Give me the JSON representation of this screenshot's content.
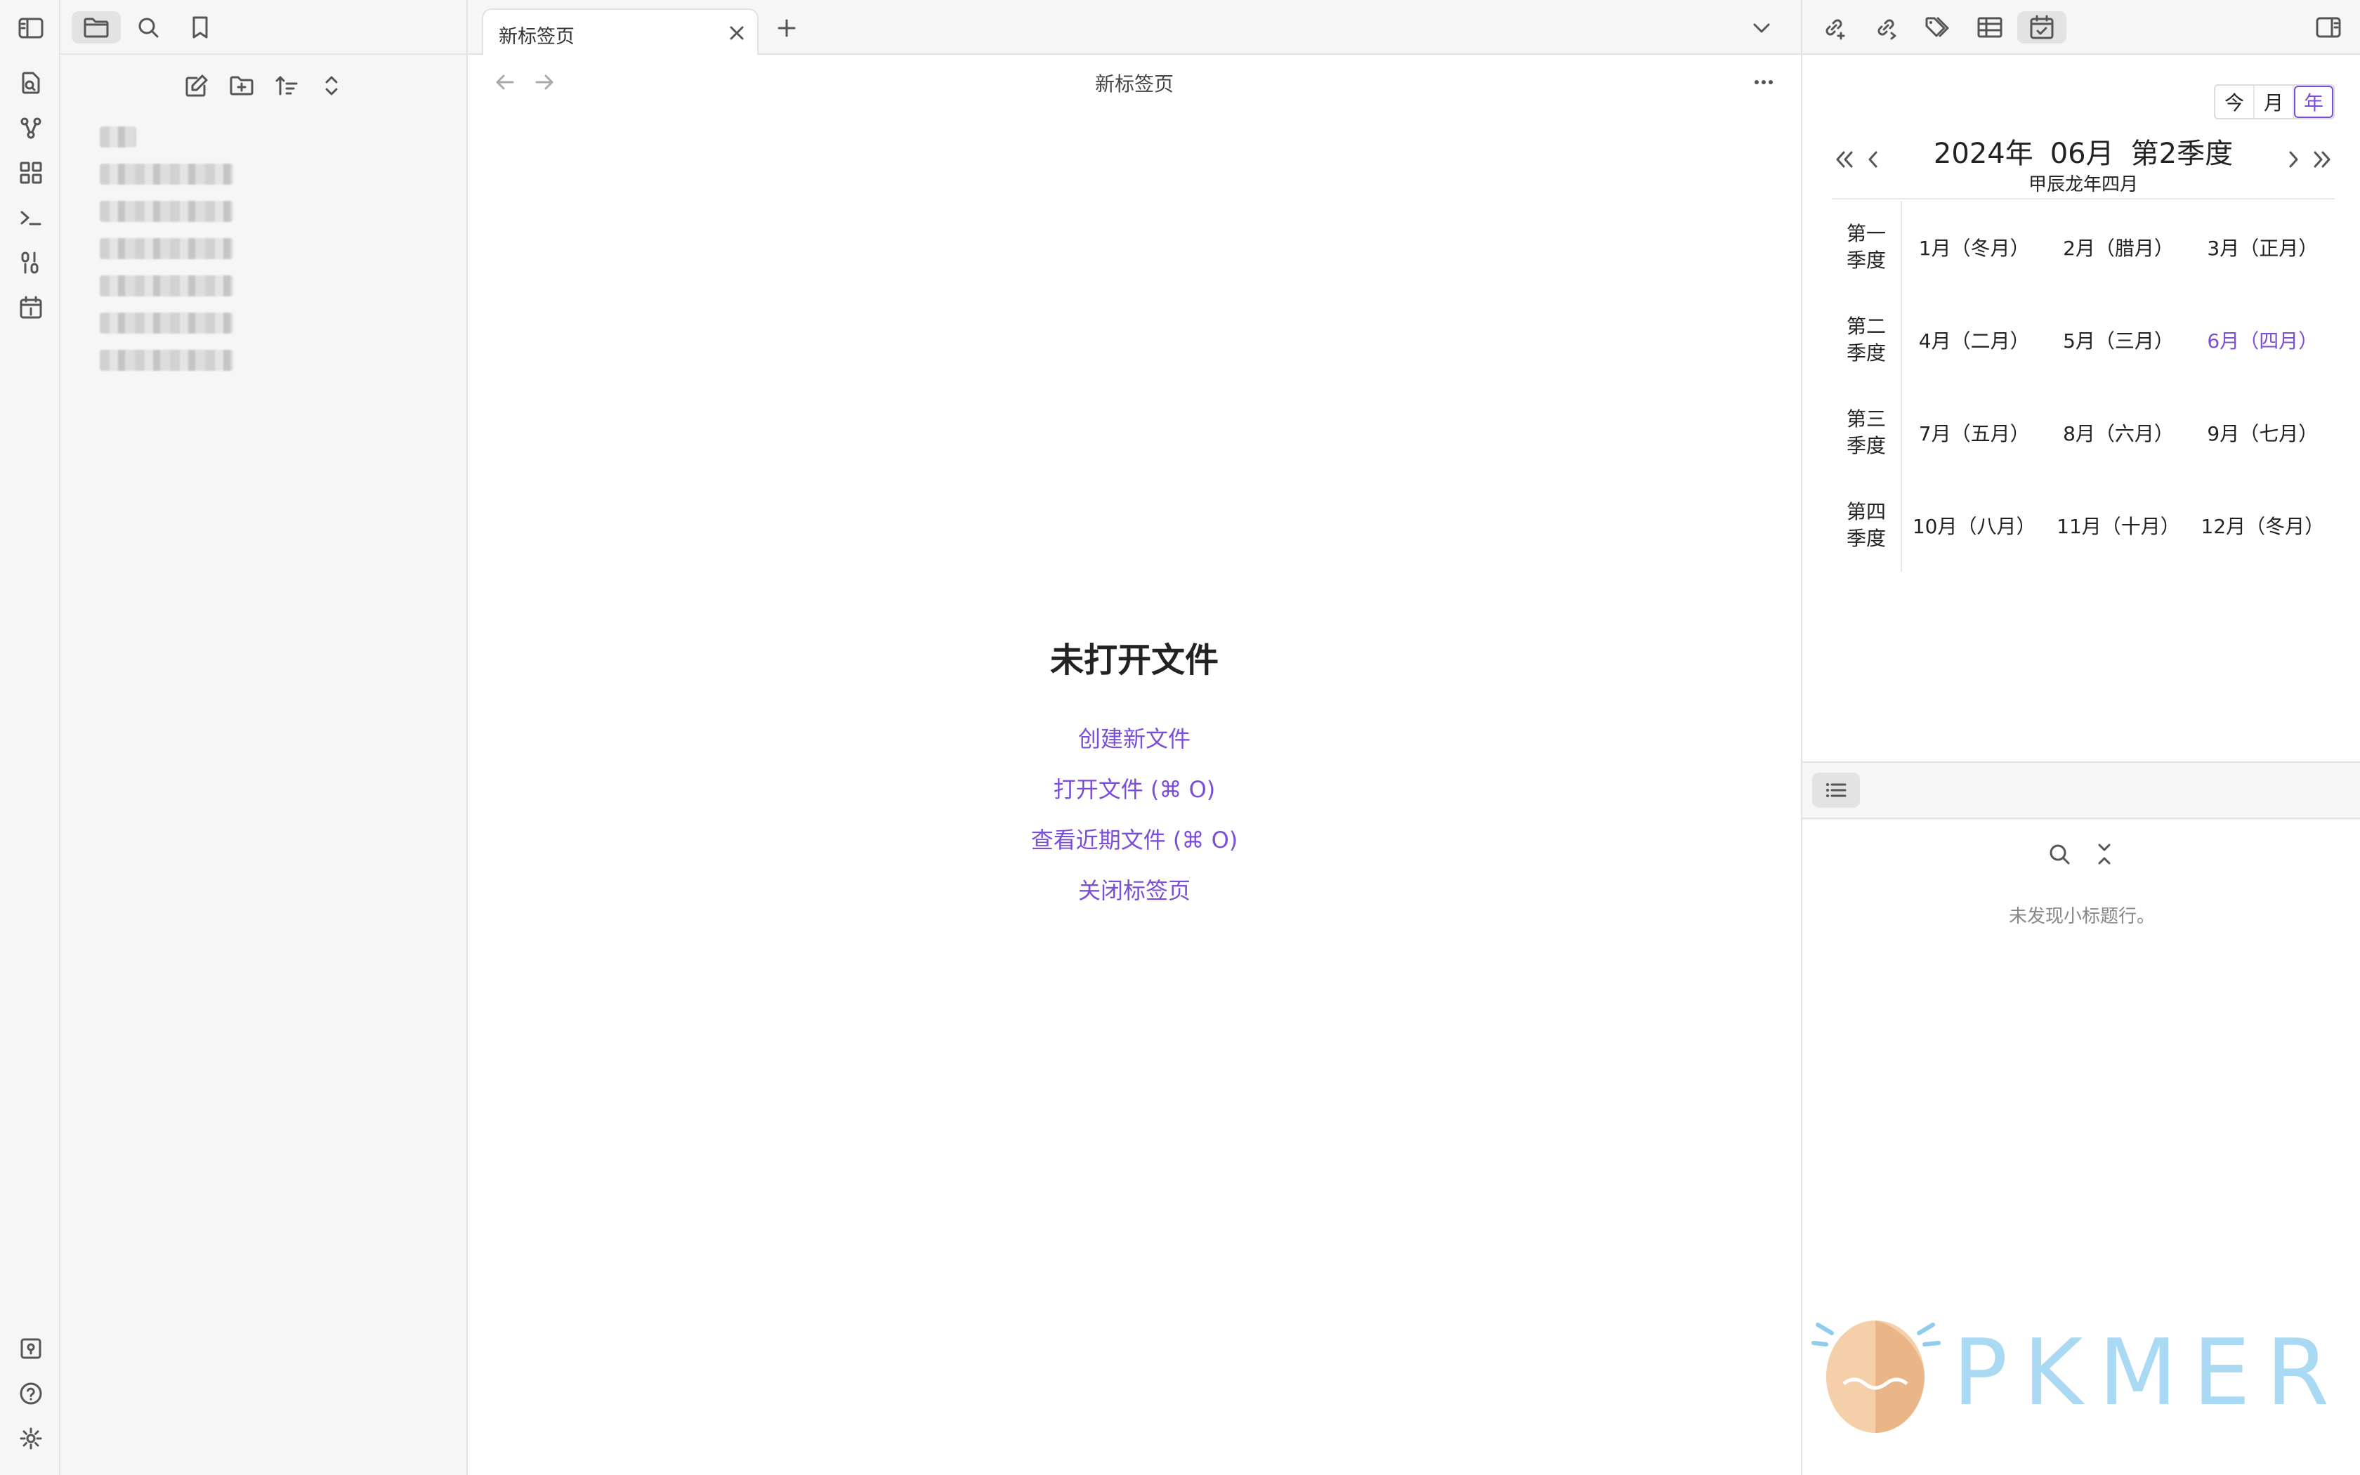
{
  "tabbar": {
    "tab_title": "新标签页"
  },
  "view": {
    "header_title": "新标签页"
  },
  "file_tree": {
    "items": [
      "████",
      "█████████",
      "█████████",
      "█████████",
      "█████████",
      "█████████",
      "█████████"
    ]
  },
  "empty_state": {
    "title": "未打开文件",
    "create": "创建新文件",
    "open": "打开文件 (⌘ O)",
    "recent": "查看近期文件 (⌘ O)",
    "close": "关闭标签页"
  },
  "calendar": {
    "view_modes": [
      "今",
      "月",
      "年"
    ],
    "active_mode": "年",
    "year": "2024年",
    "month": "06月",
    "quarter": "第2季度",
    "lunar": "甲辰龙年四月",
    "accent_color": "#7c4ddb",
    "rows": [
      {
        "label_1": "第一",
        "label_2": "季度",
        "months": [
          "1月（冬月）",
          "2月（腊月）",
          "3月（正月）"
        ]
      },
      {
        "label_1": "第二",
        "label_2": "季度",
        "months": [
          "4月（二月）",
          "5月（三月）",
          "6月（四月）"
        ]
      },
      {
        "label_1": "第三",
        "label_2": "季度",
        "months": [
          "7月（五月）",
          "8月（六月）",
          "9月（七月）"
        ]
      },
      {
        "label_1": "第四",
        "label_2": "季度",
        "months": [
          "10月（八月）",
          "11月（十月）",
          "12月（冬月）"
        ]
      }
    ],
    "current_month": "6月（四月）"
  },
  "outline": {
    "empty_text": "未发现小标题行。"
  },
  "watermark": {
    "text": "PKMER"
  },
  "icons": {
    "ribbon": [
      "sidebar-toggle-icon",
      "file-search-icon",
      "graph-icon",
      "dashboard-icon",
      "terminal-icon",
      "binary-icon",
      "calendar-icon",
      "vault-icon",
      "help-icon",
      "settings-icon"
    ],
    "explorer_tabs": [
      "folder-icon",
      "search-icon",
      "bookmark-icon"
    ],
    "explorer_actions": [
      "new-note-icon",
      "new-folder-icon",
      "sort-icon",
      "collapse-icon"
    ],
    "right_tabs": [
      "backlinks-icon",
      "outgoing-links-icon",
      "tags-icon",
      "table-icon",
      "calendar-check-icon"
    ]
  }
}
